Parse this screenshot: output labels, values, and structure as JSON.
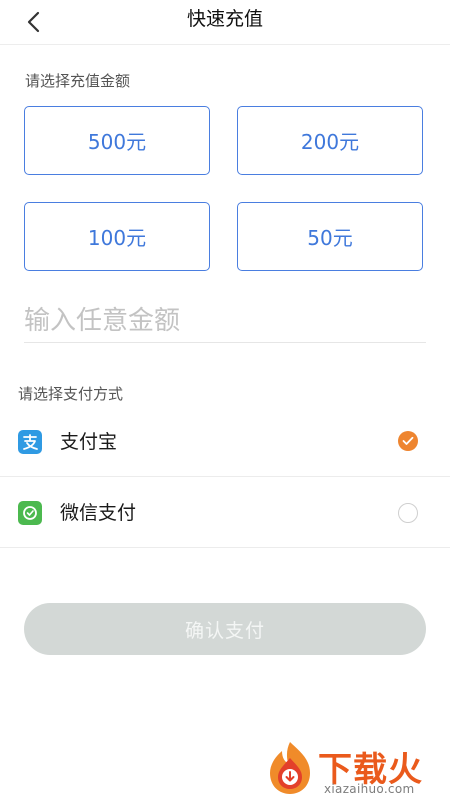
{
  "header": {
    "title": "快速充值",
    "back_icon": "chevron-left-icon"
  },
  "amount_section": {
    "label": "请选择充值金额",
    "options": [
      "500元",
      "200元",
      "100元",
      "50元"
    ],
    "accent_color": "#3f78db"
  },
  "custom_amount": {
    "placeholder": "输入任意金额",
    "value": ""
  },
  "payment_section": {
    "label": "请选择支付方式",
    "methods": [
      {
        "label": "支付宝",
        "icon": "alipay-icon",
        "selected": true
      },
      {
        "label": "微信支付",
        "icon": "wechat-pay-icon",
        "selected": false
      }
    ],
    "selected_color": "#ee8530"
  },
  "confirm": {
    "label": "确认支付",
    "color": "#d3d8d6"
  },
  "watermark": {
    "title": "下载火",
    "url": "xiazaihuo.com",
    "icon": "flame-logo-icon"
  }
}
